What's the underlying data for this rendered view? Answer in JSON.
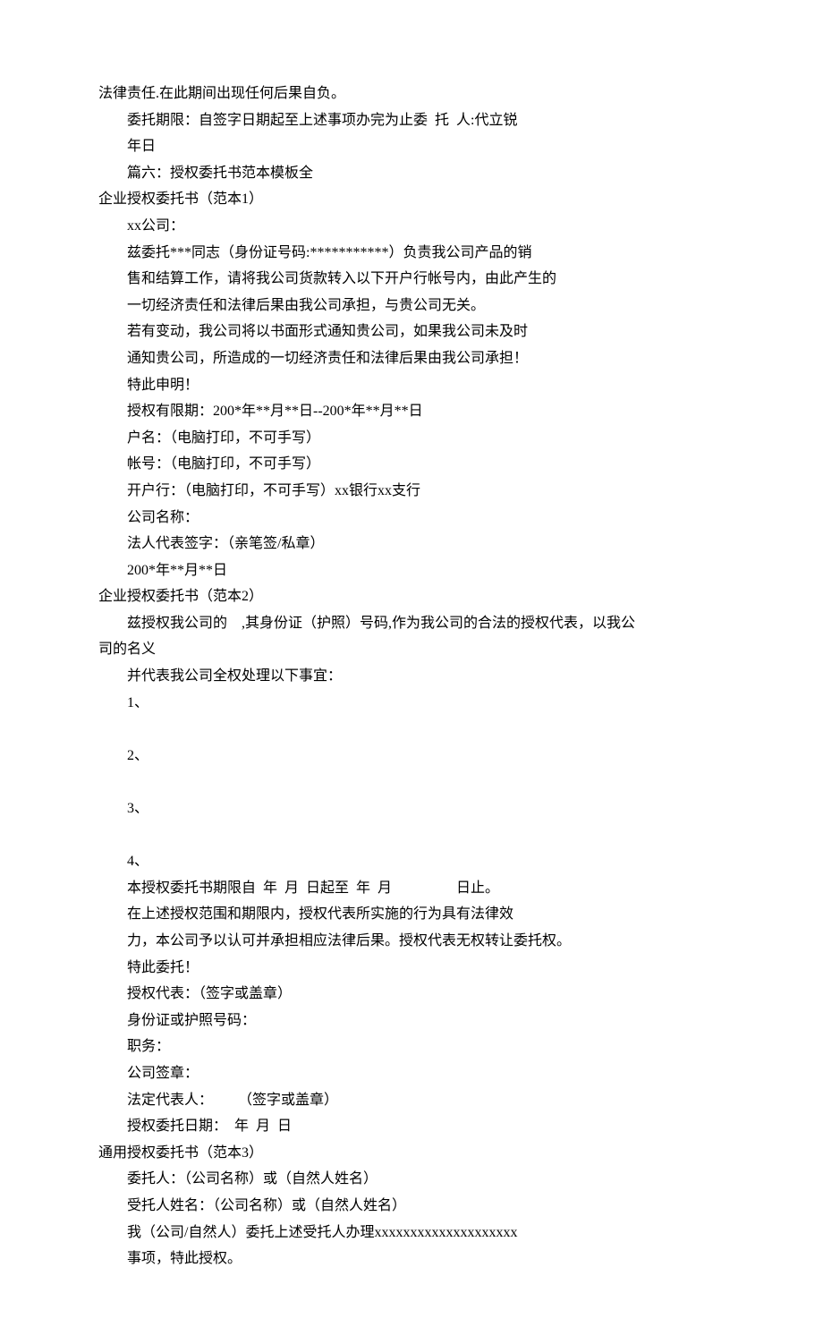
{
  "lines": [
    {
      "indent": false,
      "text": "法律责任.在此期间出现任何后果自负。"
    },
    {
      "indent": true,
      "text": "委托期限：自签字日期起至上述事项办完为止委  托  人:代立锐"
    },
    {
      "indent": true,
      "text": "年日"
    },
    {
      "indent": true,
      "text": "篇六：授权委托书范本模板全"
    },
    {
      "indent": false,
      "text": "企业授权委托书（范本1）"
    },
    {
      "indent": true,
      "text": "xx公司："
    },
    {
      "indent": true,
      "text": "兹委托***同志（身份证号码:***********）负责我公司产品的销"
    },
    {
      "indent": true,
      "text": "售和结算工作，请将我公司货款转入以下开户行帐号内，由此产生的"
    },
    {
      "indent": true,
      "text": "一切经济责任和法律后果由我公司承担，与贵公司无关。"
    },
    {
      "indent": true,
      "text": "若有变动，我公司将以书面形式通知贵公司，如果我公司未及时"
    },
    {
      "indent": true,
      "text": "通知贵公司，所造成的一切经济责任和法律后果由我公司承担！"
    },
    {
      "indent": true,
      "text": "特此申明！"
    },
    {
      "indent": true,
      "text": "授权有限期：200*年**月**日--200*年**月**日"
    },
    {
      "indent": true,
      "text": "户名：（电脑打印，不可手写）"
    },
    {
      "indent": true,
      "text": "帐号：（电脑打印，不可手写）"
    },
    {
      "indent": true,
      "text": "开户行：（电脑打印，不可手写）xx银行xx支行"
    },
    {
      "indent": true,
      "text": "公司名称："
    },
    {
      "indent": true,
      "text": "法人代表签字：（亲笔签/私章）"
    },
    {
      "indent": true,
      "text": "200*年**月**日"
    },
    {
      "indent": false,
      "text": "企业授权委托书（范本2）"
    },
    {
      "indent": true,
      "text": "兹授权我公司的    ,其身份证（护照）号码,作为我公司的合法的授权代表，以我公"
    },
    {
      "indent": false,
      "text": "司的名义"
    },
    {
      "indent": true,
      "text": "并代表我公司全权处理以下事宜："
    },
    {
      "indent": true,
      "text": "1、"
    },
    {
      "indent": true,
      "text": " "
    },
    {
      "indent": true,
      "text": "2、"
    },
    {
      "indent": true,
      "text": " "
    },
    {
      "indent": true,
      "text": "3、"
    },
    {
      "indent": true,
      "text": " "
    },
    {
      "indent": true,
      "text": "4、"
    },
    {
      "indent": true,
      "text": "本授权委托书期限自  年  月  日起至  年  月                  日止。"
    },
    {
      "indent": true,
      "text": "在上述授权范围和期限内，授权代表所实施的行为具有法律效"
    },
    {
      "indent": true,
      "text": "力，本公司予以认可并承担相应法律后果。授权代表无权转让委托权。"
    },
    {
      "indent": true,
      "text": "特此委托！"
    },
    {
      "indent": true,
      "text": "授权代表：（签字或盖章）"
    },
    {
      "indent": true,
      "text": "身份证或护照号码："
    },
    {
      "indent": true,
      "text": "职务："
    },
    {
      "indent": true,
      "text": "公司签章："
    },
    {
      "indent": true,
      "text": "法定代表人：       （签字或盖章）"
    },
    {
      "indent": true,
      "text": "授权委托日期：  年  月  日"
    },
    {
      "indent": false,
      "text": "通用授权委托书（范本3）"
    },
    {
      "indent": true,
      "text": "委托人：（公司名称）或（自然人姓名）"
    },
    {
      "indent": true,
      "text": "受托人姓名：（公司名称）或（自然人姓名）"
    },
    {
      "indent": true,
      "text": "我（公司/自然人）委托上述受托人办理xxxxxxxxxxxxxxxxxxxx"
    },
    {
      "indent": true,
      "text": "事项，特此授权。"
    }
  ]
}
